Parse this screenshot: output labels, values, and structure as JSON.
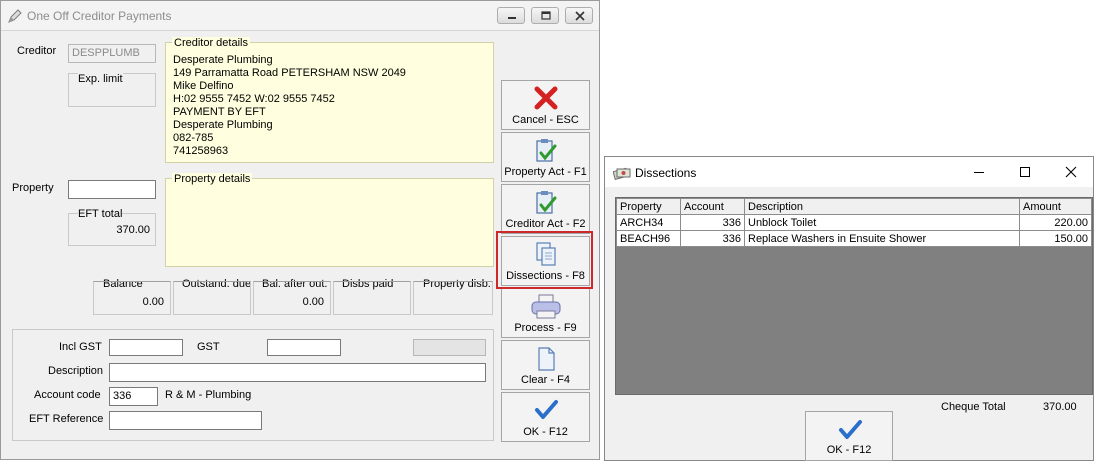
{
  "main": {
    "title": "One Off Creditor Payments",
    "creditor_label": "Creditor",
    "creditor_code": "DESPPLUMB",
    "exp_limit_label": "Exp. limit",
    "creditor_details_title": "Creditor details",
    "creditor_details": [
      "Desperate Plumbing",
      "149 Parramatta Road PETERSHAM NSW 2049",
      "Mike Delfino",
      "H:02 9555 7452 W:02 9555 7452",
      "PAYMENT BY EFT",
      "Desperate Plumbing",
      "082-785",
      "741258963"
    ],
    "property_label": "Property",
    "property_value": "",
    "property_details_title": "Property details",
    "eft_total_label": "EFT total",
    "eft_total_value": "370.00",
    "balances": {
      "balance_label": "Balance",
      "balance_value": "0.00",
      "outstanding_label": "Outstand. due",
      "bal_after_label": "Bal. after out.",
      "bal_after_value": "0.00",
      "disbs_paid_label": "Disbs paid",
      "property_disb_label": "Property disb."
    },
    "form": {
      "incl_gst_label": "Incl GST",
      "incl_gst_value": "",
      "gst_label": "GST",
      "gst_value": "",
      "description_label": "Description",
      "description_value": "",
      "account_code_label": "Account code",
      "account_code_value": "336",
      "account_name": "R & M - Plumbing",
      "eft_reference_label": "EFT Reference",
      "eft_reference_value": ""
    },
    "buttons": {
      "cancel": "Cancel - ESC",
      "property_act": "Property Act - F1",
      "creditor_act": "Creditor Act - F2",
      "dissections": "Dissections - F8",
      "process": "Process - F9",
      "clear": "Clear - F4",
      "ok": "OK - F12"
    }
  },
  "dissections": {
    "title": "Dissections",
    "columns": [
      "Property",
      "Account",
      "Description",
      "Amount"
    ],
    "rows": [
      {
        "property": "ARCH34",
        "account": "336",
        "description": "Unblock Toilet",
        "amount": "220.00"
      },
      {
        "property": "BEACH96",
        "account": "336",
        "description": "Replace Washers in Ensuite Shower",
        "amount": "150.00"
      }
    ],
    "cheque_total_label": "Cheque Total",
    "cheque_total_value": "370.00",
    "ok_button": "OK - F12"
  },
  "colors": {
    "highlight": "#cc2a2a",
    "details_background": "#ffffdf",
    "grid_background": "#808080"
  }
}
